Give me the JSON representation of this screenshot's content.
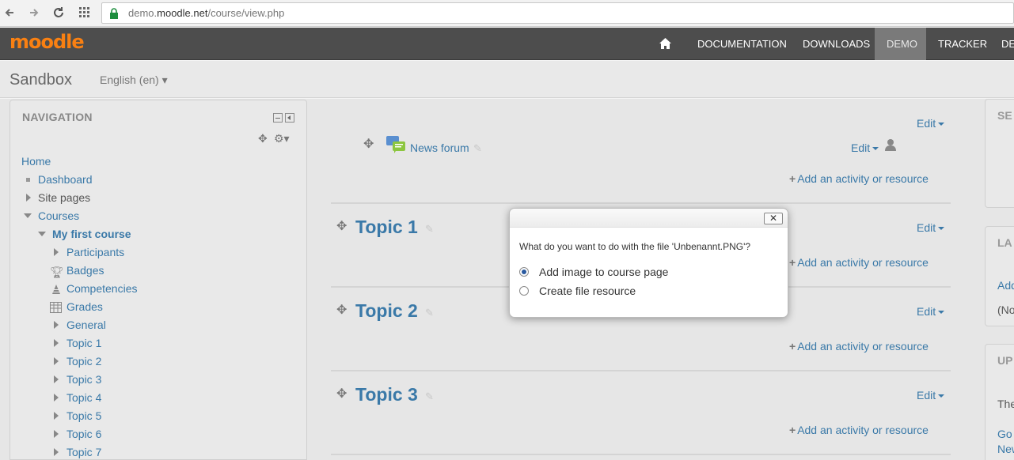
{
  "browser": {
    "url_prefix": "demo.",
    "url_domain": "moodle.net",
    "url_path": "/course/view.php"
  },
  "topbar": {
    "logo": "moodle",
    "items": [
      "DOCUMENTATION",
      "DOWNLOADS",
      "DEMO",
      "TRACKER",
      "DE"
    ],
    "active": "DEMO",
    "accent": "#f98012"
  },
  "header": {
    "brand": "Sandbox",
    "language": "English (en) ▾"
  },
  "navigation": {
    "title": "NAVIGATION",
    "items": [
      "Home",
      "Dashboard",
      "Site pages",
      "Courses",
      "My first course",
      "Participants",
      "Badges",
      "Competencies",
      "Grades",
      "General",
      "Topic 1",
      "Topic 2",
      "Topic 3",
      "Topic 4",
      "Topic 5",
      "Topic 6",
      "Topic 7"
    ]
  },
  "main": {
    "edit_label": "Edit",
    "add_activity": "Add an activity or resource",
    "news_forum": "News forum",
    "topics": [
      "Topic 1",
      "Topic 2",
      "Topic 3"
    ]
  },
  "right_blocks": {
    "search_title": "SE",
    "latest_title": "LA",
    "latest_link": "Add",
    "latest_text": "(No",
    "upcoming_title": "UP",
    "upcoming_text": "The",
    "upcoming_link1": "Go",
    "upcoming_link2": "New"
  },
  "dialog": {
    "close_label": "✕",
    "question": "What do you want to do with the file 'Unbenannt.PNG'?",
    "options": [
      "Add image to course page",
      "Create file resource"
    ],
    "selected": "Add image to course page"
  }
}
